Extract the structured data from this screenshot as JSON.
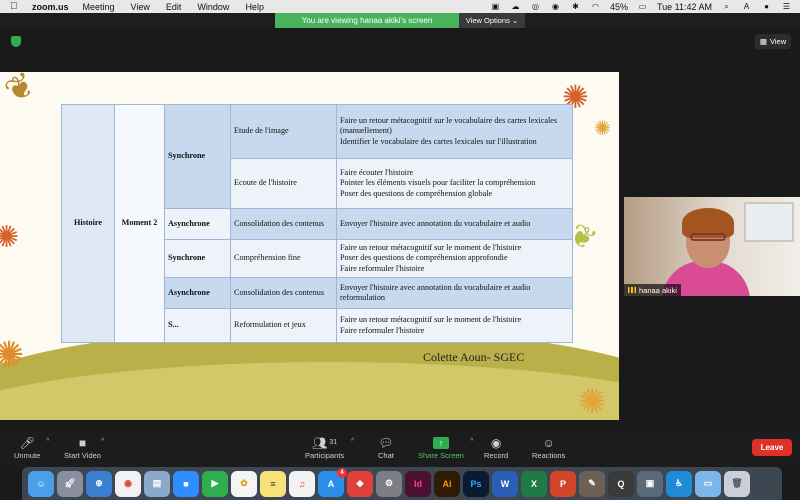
{
  "menubar": {
    "app_name": "zoom.us",
    "items": [
      "Meeting",
      "View",
      "Edit",
      "Window",
      "Help"
    ],
    "battery": "45%",
    "clock": "Tue 11:42 AM",
    "input_indicator": "A"
  },
  "zoom": {
    "banner_text": "You are viewing hanaa akiki's screen",
    "view_options_label": "View Options ⌄",
    "view_label": "View"
  },
  "slide": {
    "credit": "Colette Aoun- SGEC",
    "table": {
      "col1": "Histoire",
      "col2": "Moment 2",
      "rows": [
        {
          "mode": "Synchrone",
          "activity": "Etude de l'image",
          "description": "Faire un retour métacognitif  sur le vocabulaire des cartes lexicales (manuellement)\nIdentifier le vocabulaire des cartes lexicales sur l'illustration"
        },
        {
          "mode": "",
          "activity": "Ecoute de l'histoire",
          "description": "Faire écouter l'histoire\nPointer les éléments visuels pour faciliter la compréhension\nPoser des questions de compréhension globale"
        },
        {
          "mode": "Asynchrone",
          "activity": "Consolidation des contenus",
          "description": "Envoyer l'histoire avec annotation du vocabulaire et audio"
        },
        {
          "mode": "Synchrone",
          "activity": "Compréhension fine",
          "description": "Faire un retour métacognitif  sur le moment de l'histoire\nPoser des questions de compréhension approfondie\nFaire reformuler l'histoire"
        },
        {
          "mode": "Asynchrone",
          "activity": "Consolidation des contenus",
          "description": "Envoyer l'histoire avec annotation du vocabulaire et audio reformulation"
        },
        {
          "mode": "S...",
          "activity": "Reformulation et jeux",
          "description": "Faire un retour métacognitif  sur le moment de l'histoire\nFaire reformuler l'histoire"
        }
      ]
    }
  },
  "participant": {
    "name": "hanaa akiki"
  },
  "toolbar": {
    "unmute": "Unmute",
    "start_video": "Start Video",
    "participants": "Participants",
    "participants_count": "31",
    "chat": "Chat",
    "share_screen": "Share Screen",
    "record": "Record",
    "reactions": "Reactions",
    "leave": "Leave"
  },
  "dock": {
    "apps": [
      "finder-icon",
      "launchpad-icon",
      "safari-icon",
      "chrome-icon",
      "preview-icon",
      "zoom-icon",
      "facetime-icon",
      "photos-icon",
      "notes-icon",
      "itunes-icon",
      "appstore-icon",
      "anydesk-icon",
      "system-preferences-icon",
      "indesign-icon",
      "illustrator-icon",
      "photoshop-icon",
      "word-icon",
      "excel-icon",
      "powerpoint-icon",
      "gimp-icon",
      "quicktime-icon",
      "sim-icon",
      "accessibility-icon",
      "folder-icon",
      "trash-icon"
    ],
    "labels": {
      "indesign": "Id",
      "illustrator": "Ai",
      "photoshop": "Ps",
      "word": "W",
      "excel": "X",
      "powerpoint": "P"
    },
    "appstore_badge": "4"
  }
}
